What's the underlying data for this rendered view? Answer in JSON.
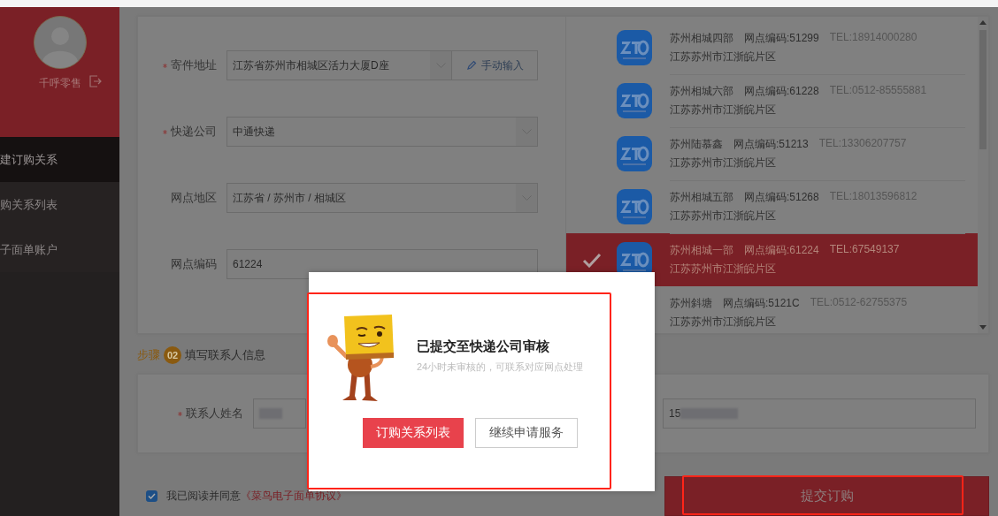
{
  "sidebar": {
    "username": "千呼零售",
    "menu": [
      {
        "label": "建订购关系",
        "selected": true
      },
      {
        "label": "购关系列表",
        "selected": false
      },
      {
        "label": "子面单账户",
        "selected": false
      }
    ]
  },
  "form": {
    "fields": [
      {
        "label": "寄件地址",
        "required": true,
        "value": "江苏省苏州市相城区活力大厦D座",
        "kind": "select-manual"
      },
      {
        "label": "快递公司",
        "required": true,
        "value": "中通快递",
        "kind": "select"
      },
      {
        "label": "网点地区",
        "required": false,
        "value": "江苏省 / 苏州市 / 相城区",
        "kind": "select"
      },
      {
        "label": "网点编码",
        "required": false,
        "value": "61224",
        "kind": "input"
      }
    ],
    "manual_button": "手动输入"
  },
  "stations": [
    {
      "name": "苏州相城四部",
      "code": "网点编码:51299",
      "tel": "TEL:18914000280",
      "area": "江苏苏州市江浙皖片区",
      "selected": false
    },
    {
      "name": "苏州相城六部",
      "code": "网点编码:61228",
      "tel": "TEL:0512-85555881",
      "area": "江苏苏州市江浙皖片区",
      "selected": false
    },
    {
      "name": "苏州陆慕鑫",
      "code": "网点编码:51213",
      "tel": "TEL:13306207757",
      "area": "江苏苏州市江浙皖片区",
      "selected": false
    },
    {
      "name": "苏州相城五部",
      "code": "网点编码:51268",
      "tel": "TEL:18013596812",
      "area": "江苏苏州市江浙皖片区",
      "selected": false
    },
    {
      "name": "苏州相城一部",
      "code": "网点编码:61224",
      "tel": "TEL:67549137",
      "area": "江苏苏州市江浙皖片区",
      "selected": true
    },
    {
      "name": "苏州斜塘",
      "code": "网点编码:5121C",
      "tel": "TEL:0512-62755375",
      "area": "江苏苏州市江浙皖片区",
      "selected": false
    }
  ],
  "step2": {
    "word": "步骤",
    "number": "02",
    "title": "填写联系人信息"
  },
  "contact": {
    "name_label": "联系人姓名",
    "required": true,
    "phone_value": "15"
  },
  "agreement": {
    "checked": true,
    "text": "我已阅读并同意",
    "link": "《菜鸟电子面单协议》"
  },
  "submit_button": "提交订购",
  "dialog": {
    "title": "已提交至快递公司审核",
    "subtitle": "24小时未审核的，可联系对应网点处理",
    "buttons": [
      {
        "label": "订购关系列表",
        "kind": "primary"
      },
      {
        "label": "继续申请服务",
        "kind": "secondary"
      }
    ]
  }
}
